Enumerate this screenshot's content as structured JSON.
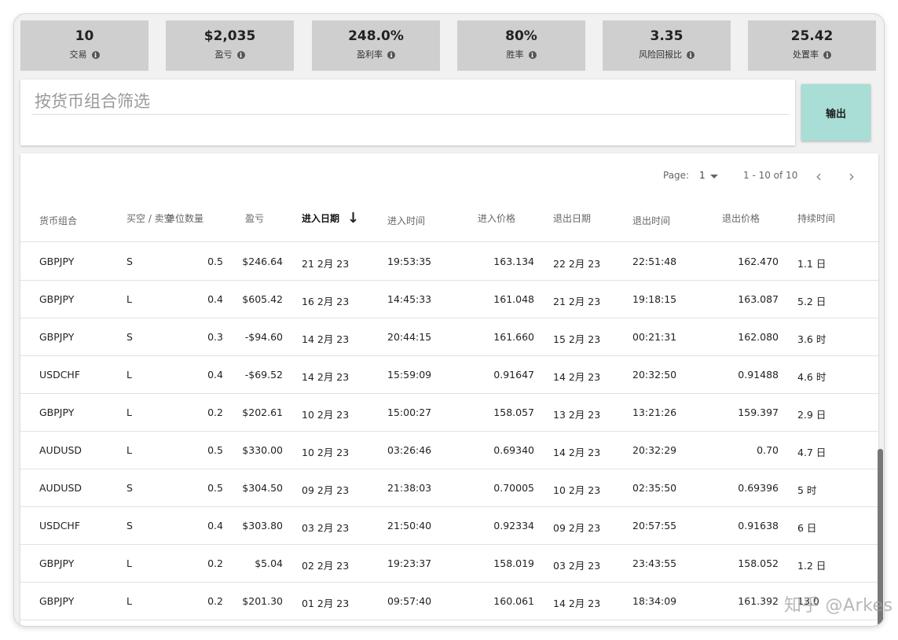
{
  "stats": [
    {
      "value": "10",
      "label": "交易"
    },
    {
      "value": "$2,035",
      "label": "盈亏"
    },
    {
      "value": "248.0%",
      "label": "盈利率"
    },
    {
      "value": "80%",
      "label": "胜率"
    },
    {
      "value": "3.35",
      "label": "风险回报比"
    },
    {
      "value": "25.42",
      "label": "处置率"
    }
  ],
  "filter": {
    "placeholder": "按货币组合筛选",
    "value": ""
  },
  "export_label": "输出",
  "pager": {
    "label": "Page:",
    "page": "1",
    "range": "1 - 10 of 10",
    "prev": "‹",
    "next": "›"
  },
  "columns": [
    "货币组合",
    "买空 / 卖空",
    "单位数量",
    "盈亏",
    "进入日期",
    "进入时间",
    "进入价格",
    "退出日期",
    "退出时间",
    "退出价格",
    "持续时间"
  ],
  "sorted_column": "进入日期",
  "rows": [
    [
      "GBPJPY",
      "S",
      "0.5",
      "$246.64",
      "21 2月 23",
      "19:53:35",
      "163.134",
      "22 2月 23",
      "22:51:48",
      "162.470",
      "1.1 日"
    ],
    [
      "GBPJPY",
      "L",
      "0.4",
      "$605.42",
      "16 2月 23",
      "14:45:33",
      "161.048",
      "21 2月 23",
      "19:18:15",
      "163.087",
      "5.2 日"
    ],
    [
      "GBPJPY",
      "S",
      "0.3",
      "-$94.60",
      "14 2月 23",
      "20:44:15",
      "161.660",
      "15 2月 23",
      "00:21:31",
      "162.080",
      "3.6 时"
    ],
    [
      "USDCHF",
      "L",
      "0.4",
      "-$69.52",
      "14 2月 23",
      "15:59:09",
      "0.91647",
      "14 2月 23",
      "20:32:50",
      "0.91488",
      "4.6 时"
    ],
    [
      "GBPJPY",
      "L",
      "0.2",
      "$202.61",
      "10 2月 23",
      "15:00:27",
      "158.057",
      "13 2月 23",
      "13:21:26",
      "159.397",
      "2.9 日"
    ],
    [
      "AUDUSD",
      "L",
      "0.5",
      "$330.00",
      "10 2月 23",
      "03:26:46",
      "0.69340",
      "14 2月 23",
      "20:32:29",
      "0.70",
      "4.7 日"
    ],
    [
      "AUDUSD",
      "S",
      "0.5",
      "$304.50",
      "09 2月 23",
      "21:38:03",
      "0.70005",
      "10 2月 23",
      "02:35:50",
      "0.69396",
      "5 时"
    ],
    [
      "USDCHF",
      "S",
      "0.4",
      "$303.80",
      "03 2月 23",
      "21:50:40",
      "0.92334",
      "09 2月 23",
      "20:57:55",
      "0.91638",
      "6 日"
    ],
    [
      "GBPJPY",
      "L",
      "0.2",
      "$5.04",
      "02 2月 23",
      "19:23:37",
      "158.019",
      "03 2月 23",
      "23:43:55",
      "158.052",
      "1.2 日"
    ],
    [
      "GBPJPY",
      "L",
      "0.2",
      "$201.30",
      "01 2月 23",
      "09:57:40",
      "160.061",
      "14 2月 23",
      "18:34:09",
      "161.392",
      "13.0"
    ]
  ],
  "watermark": "知乎 @Arkes"
}
